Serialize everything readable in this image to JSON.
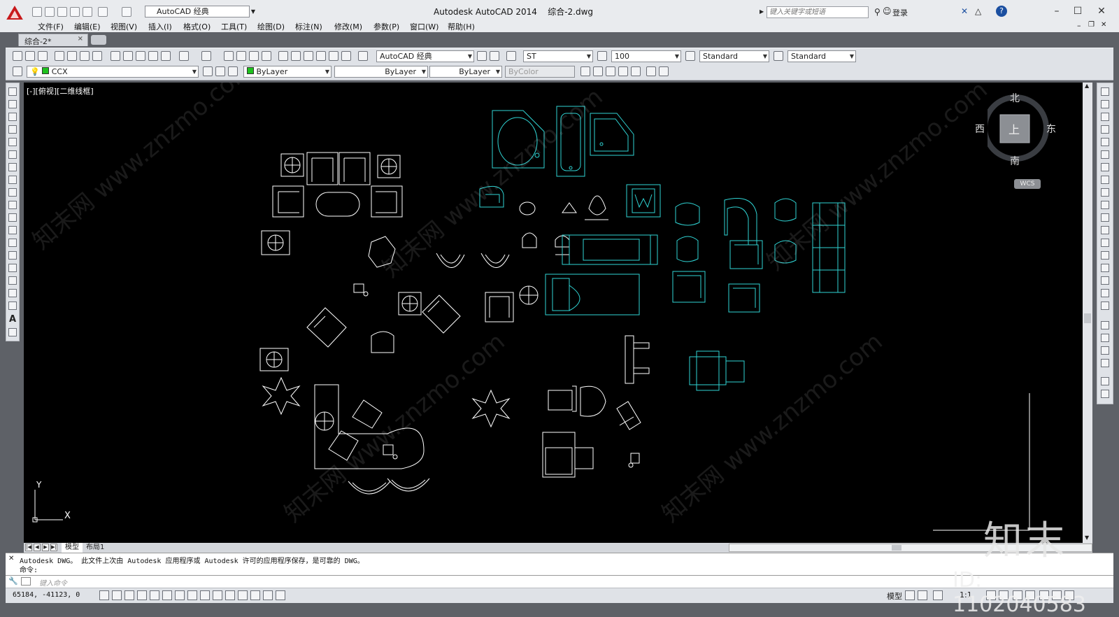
{
  "window": {
    "title": "Autodesk AutoCAD 2014",
    "document": "综合-2.dwg",
    "workspace": "AutoCAD 经典",
    "search_placeholder": "键入关键字或短语",
    "login": "登录"
  },
  "menu": [
    "文件(F)",
    "编辑(E)",
    "视图(V)",
    "插入(I)",
    "格式(O)",
    "工具(T)",
    "绘图(D)",
    "标注(N)",
    "修改(M)",
    "参数(P)",
    "窗口(W)",
    "帮助(H)"
  ],
  "doc_tab": "综合-2*",
  "toolbar": {
    "workspace_combo": "AutoCAD 经典",
    "text_style": "ST",
    "dim_scale": "100",
    "dim_style": "Standard",
    "table_style": "Standard",
    "layer": "CCX",
    "color": "ByLayer",
    "linetype": "ByLayer",
    "lineweight": "ByLayer",
    "plotstyle": "ByColor"
  },
  "viewport_label": "[-][俯视][二维线框]",
  "viewcube": {
    "north": "北",
    "south": "南",
    "east": "东",
    "west": "西",
    "top": "上",
    "wcs": "WCS"
  },
  "ucs": {
    "x": "X",
    "y": "Y"
  },
  "layout_tabs": [
    "模型",
    "布局1"
  ],
  "command": {
    "history_line1": "Autodesk DWG。  此文件上次由 Autodesk 应用程序或 Autodesk 许可的应用程序保存，是可靠的 DWG。",
    "history_line2": "命令:",
    "input_placeholder": "键入命令"
  },
  "status": {
    "coords": "65184, -41123, 0",
    "model": "模型",
    "scale": "1:1"
  },
  "watermark": {
    "logo": "知末",
    "id": "ID: 1102040583",
    "site": "知末网 www.znzmo.com"
  },
  "colors": {
    "canvas": "#000000",
    "cyan": "#2fd3d3",
    "line": "#ffffff"
  }
}
